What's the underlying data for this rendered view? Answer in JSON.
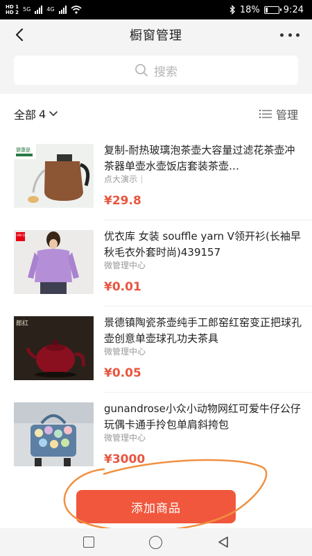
{
  "status_bar": {
    "hd1": "HD 1",
    "hd2": "HD 2",
    "net1": "5G",
    "net2": "4G",
    "battery_pct": "18%",
    "time": "9:24",
    "battery_level": 0.18,
    "icons": [
      "bluetooth-icon",
      "wifi-icon",
      "battery-icon"
    ]
  },
  "header": {
    "title": "橱窗管理",
    "back_icon": "chevron-left-icon",
    "more_icon": "more-dots-icon"
  },
  "search": {
    "placeholder": "搜索",
    "icon": "search-icon"
  },
  "filter": {
    "label": "全部",
    "count": "4",
    "manage_label": "管理",
    "manage_icon": "list-icon"
  },
  "products": [
    {
      "title": "复制-耐热玻璃泡茶壶大容量过滤花茶壶冲茶器单壶水壶饭店套装茶壶…",
      "shop": "点大演示",
      "price": "¥29.8",
      "thumb_label": "健康是"
    },
    {
      "title": "优衣库 女装 souffle yarn V领开衫(长袖早秋毛衣外套时尚)439157",
      "shop": "微管理中心",
      "price": "¥0.01",
      "thumb_label": "UNI QLO"
    },
    {
      "title": "景德镇陶瓷茶壶纯手工郎窑红窑变正把球孔壶创意单壶球孔功夫茶具",
      "shop": "微管理中心",
      "price": "¥0.05",
      "thumb_label": "郎红"
    },
    {
      "title": "gunandrose小众小动物网红可爱牛仔公仔玩偶卡通手拎包单肩斜挎包",
      "shop": "微管理中心",
      "price": "¥3000",
      "thumb_label": ""
    }
  ],
  "bottom": {
    "add_label": "添加商品"
  },
  "colors": {
    "accent": "#f1573d",
    "price": "#e8553f",
    "annotation": "#f09040"
  },
  "system_nav": {
    "icons": [
      "recent-apps-icon",
      "home-icon",
      "back-icon"
    ]
  }
}
